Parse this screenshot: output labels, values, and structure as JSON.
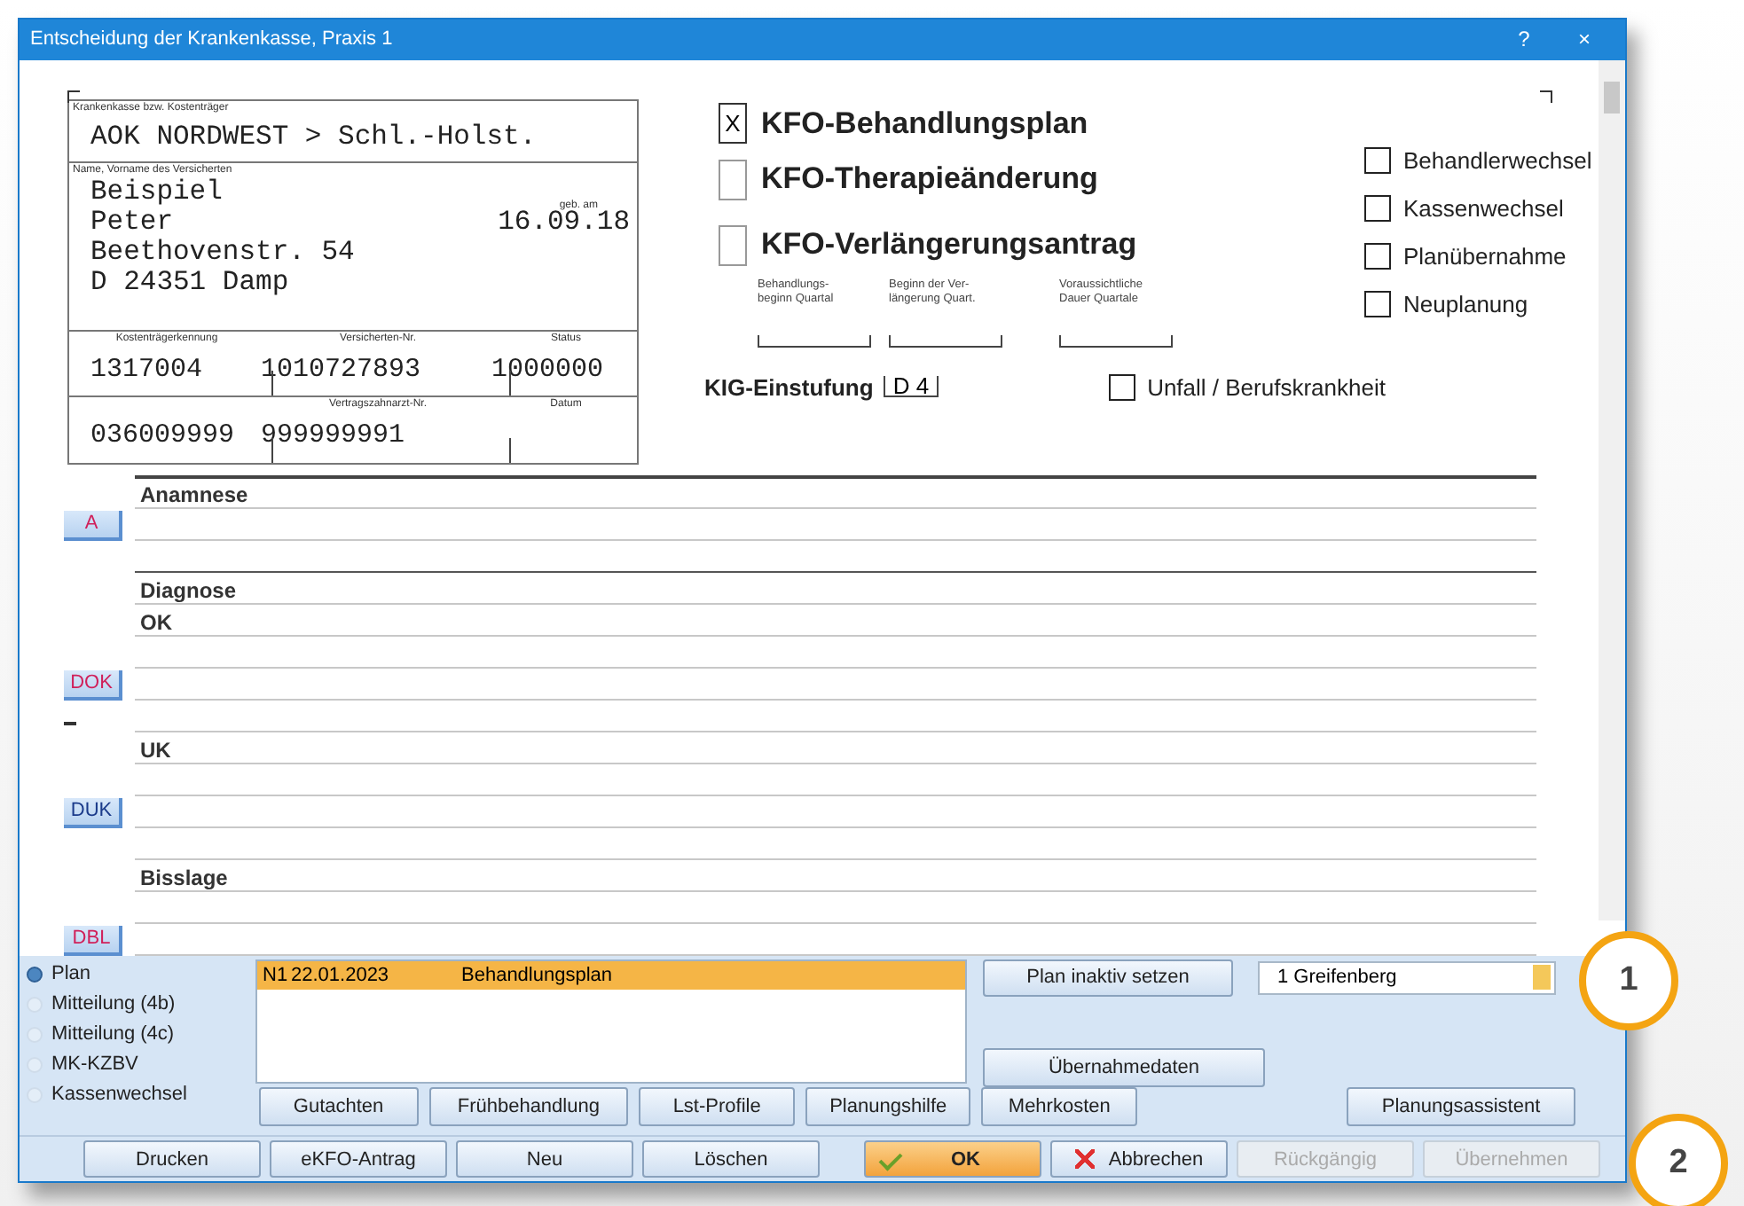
{
  "window": {
    "title": "Entscheidung der Krankenkasse, Praxis 1",
    "help": "?",
    "close": "×"
  },
  "card": {
    "payer_label": "Krankenkasse bzw. Kostenträger",
    "payer": "AOK NORDWEST > Schl.-Holst.",
    "name_label": "Name, Vorname des Versicherten",
    "surname": "Beispiel",
    "firstname": "Peter",
    "birth_label": "geb. am",
    "birth": "16.09.18",
    "street": "Beethovenstr. 54",
    "city": "D 24351 Damp",
    "ids": [
      {
        "label": "Kostenträgerkennung",
        "value": "1317004"
      },
      {
        "label": "Versicherten-Nr.",
        "value": "1010727893"
      },
      {
        "label": "Status",
        "value": "1000000"
      }
    ],
    "bottom": [
      {
        "value": "036009999"
      },
      {
        "label": "Vertragszahnarzt-Nr.",
        "value": "999999991"
      },
      {
        "label": "Datum"
      }
    ]
  },
  "plan_types": [
    {
      "label": "KFO-Behandlungsplan",
      "checked": true,
      "mark": "X"
    },
    {
      "label": "KFO-Therapieänderung",
      "checked": false
    },
    {
      "label": "KFO-Verlängerungsantrag",
      "checked": false
    }
  ],
  "quarters": [
    "Behandlungs-\nbeginn Quartal",
    "Beginn der Ver-\nlängerung Quart.",
    "Voraussichtliche\nDauer Quartale"
  ],
  "options": [
    {
      "label": "Behandlerwechsel",
      "checked": false
    },
    {
      "label": "Kassenwechsel",
      "checked": false
    },
    {
      "label": "Planübernahme",
      "checked": false
    },
    {
      "label": "Neuplanung",
      "checked": false
    }
  ],
  "kig": {
    "label": "KIG-Einstufung",
    "value": "D 4"
  },
  "accident": {
    "label": "Unfall / Berufskrankheit",
    "checked": false
  },
  "note_rows": [
    {
      "heading": "Anamnese",
      "heavy": true
    },
    {
      "button": {
        "label": "A",
        "color": "#d0205a"
      }
    },
    {},
    {
      "heading": "Diagnose",
      "heavy": true
    },
    {
      "heading": "OK"
    },
    {},
    {
      "button": {
        "label": "DOK",
        "color": "#d0205a"
      }
    },
    {
      "dash": true
    },
    {
      "heading": "UK"
    },
    {},
    {
      "button": {
        "label": "DUK",
        "color": "#1a3a8a"
      }
    },
    {},
    {
      "heading": "Bisslage"
    },
    {},
    {
      "button": {
        "label": "DBL",
        "color": "#d0205a"
      }
    }
  ],
  "doc_types": [
    {
      "label": "Plan",
      "selected": true
    },
    {
      "label": "Mitteilung (4b)",
      "selected": false
    },
    {
      "label": "Mitteilung (4c)",
      "selected": false
    },
    {
      "label": "MK-KZBV",
      "selected": false
    },
    {
      "label": "Kassenwechsel",
      "selected": false
    }
  ],
  "plans": [
    {
      "number": "N1",
      "date": "22.01.2023",
      "type": "Behandlungsplan",
      "selected": true
    }
  ],
  "plan_inactive_button": "Plan inaktiv setzen",
  "location": {
    "value": "1 Greifenberg"
  },
  "takeover_button": "Übernahmedaten",
  "tool_buttons": [
    "Gutachten",
    "Frühbehandlung",
    "Lst-Profile",
    "Planungshilfe",
    "Mehrkosten"
  ],
  "assistant_button": "Planungsassistent",
  "footer_buttons": [
    {
      "label": "Drucken",
      "kind": "plain",
      "disabled": false
    },
    {
      "label": "eKFO-Antrag",
      "kind": "plain",
      "disabled": false
    },
    {
      "label": "Neu",
      "kind": "plain",
      "disabled": false
    },
    {
      "label": "Löschen",
      "kind": "plain",
      "disabled": false
    },
    {
      "label": "OK",
      "kind": "ok",
      "disabled": false
    },
    {
      "label": "Abbrechen",
      "kind": "cancel",
      "disabled": false
    },
    {
      "label": "Rückgängig",
      "kind": "plain",
      "disabled": true
    },
    {
      "label": "Übernehmen",
      "kind": "plain",
      "disabled": true
    }
  ],
  "callouts": [
    "1",
    "2"
  ]
}
